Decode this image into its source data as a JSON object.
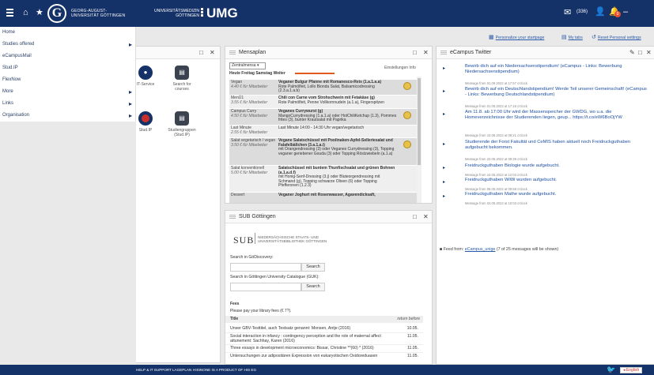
{
  "topbar": {
    "uni_name": "GEORG-AUGUST-UNIVERSITÄT GÖTTINGEN",
    "ugm_small": "UNIVERSITÄTSMEDIZIN GÖTTINGEN",
    "ugm": "UMG",
    "mail_count": "(336)",
    "notif_count": "0"
  },
  "nav": {
    "items": [
      {
        "label": "Home",
        "has_children": false
      },
      {
        "label": "Studies offered",
        "has_children": true
      },
      {
        "label": "eCampusMail",
        "has_children": false
      },
      {
        "label": "Stud.IP",
        "has_children": false
      },
      {
        "label": "FlexNow",
        "has_children": false
      },
      {
        "label": "More",
        "has_children": true
      },
      {
        "label": "Links",
        "has_children": true
      },
      {
        "label": "Organisation",
        "has_children": true
      }
    ]
  },
  "tools": {
    "personalize": "Personalize your startpage",
    "my_tabs": "My tabs",
    "reset": "Reset Personal settings"
  },
  "quicklinks": {
    "items": [
      {
        "label": "IT-Service"
      },
      {
        "label": "Search for courses"
      },
      {
        "label": "Stud.IP"
      },
      {
        "label": "Studiengruppen (Stud.IP)"
      }
    ]
  },
  "mensa": {
    "title": "Mensaplan",
    "select": "Zentralmensa",
    "date": "Heute Freitag Samstag Weiter",
    "info_link": "Einstellungen Info",
    "rows": [
      {
        "cat": "Vegan",
        "price": "4.40 € für Mitarbeiter",
        "name": "Veganer Bulgur Pfanne mit Romanesco-Reis (1.a.1.a.a)",
        "desc": "Rote Palmölfeit, Lollo Bionda Salat, Balsamicodressing (2.3.a.1.a.b)"
      },
      {
        "cat": "MenÜ1",
        "price": "3.55 € für Mitarbeiter",
        "name": "Chili con Carne vom Strohschwein mit Fetakäse (g)",
        "desc": "Rote Palmölfeit, Penne Vollkornnudeln (a.1.a), Fingerspitzen"
      },
      {
        "cat": "Campus Curry",
        "price": "4.50 € für Mitarbeiter",
        "name": "Veganes Currywurst (g)",
        "desc": "MangoCurrydressing (1.a.1.a) oder HotChiliKetchup (1.3), Pommes frites (3), bunter Krautsalat mit Paprika"
      },
      {
        "cat": "Last Minute",
        "price": "2.55 € für Mitarbeiter",
        "name": "",
        "desc": "Last Minute 14:00 - 14:30 Uhr vegan/vegetarisch"
      },
      {
        "cat": "Salat vegetarisch / vegan",
        "price": "3.50 € für Mitarbeiter",
        "name": "Vegane Salatschüssel mit Poolinaken-Apfel-Selleriesalat und Falafelbällchen (3.a.1.a.i)",
        "desc": "mit Orangendressing (3) oder Veganes Currydressing (3), Topping veganer geriebener Gouda (3) oder Topping Röstzwiebeln (a.1.a)"
      },
      {
        "cat": "Salat konventionell",
        "price": "5.00 € für Mitarbeiter",
        "name": "Salatschüssel mit buntem Thunfischsalat und grünen Bohnen (a.1.a.d.f)",
        "desc": "mit Honig-Senf-Dressing (3.j) oder Bluteorgendressing mit Schmand (g), Topping schwarze Oliven (6) oder Topping Pfefferonen (1.2.3)"
      },
      {
        "cat": "Dessert",
        "price": "",
        "name": "Veganer Joghurt mit Rosenwasser, Agavendicksaft,",
        "desc": ""
      }
    ]
  },
  "sub": {
    "title": "SUB Göttingen",
    "logo": "SUB",
    "logo_text": "NIEDERSÄCHSISCHE STAATS- UND UNIVERSITÄTSBIBLIOTHEK GÖTTINGEN",
    "search_label_1": "Search in GöDiscovery:",
    "search_label_2": "Search in Göttingen University Catalogue (GUK):",
    "search_btn": "Search",
    "fees_heading": "Fees",
    "fees_text": "Please pay your library fees (€ 7?).",
    "loans_title": "Title",
    "loans_return": "return before",
    "loans": [
      {
        "title": "Unser GBV-Testtitel, auch Testsatz genannt: Monsen, Antje (2016)",
        "date": "10.05."
      },
      {
        "title": "Social interaction in infancy : contingency perception and the role of maternal affect attunement: Sachhay, Karen (2016)",
        "date": "11.05."
      },
      {
        "title": "Three essays in development microeconomics: Bissar, Christine **(60) * (2016)",
        "date": "11.05."
      },
      {
        "title": "Untersuchungen zur adipositären Expression von eukaryotischen Oxidoreduasen",
        "date": "11.05."
      }
    ]
  },
  "twitter": {
    "title": "eCampus Twitter",
    "tweets": [
      {
        "text": "Bewirb dich auf ein Niedersachsenstipendium! (eCampus - Links: Bewerbung Niedersachsenstipendium)",
        "meta": "Message from 01.09.2022 at 17:57 o'clock"
      },
      {
        "text": "Bewirb dich auf ein Deutschlandstipendium! Werde Teil unserer Gemeinschaft! (eCampus - Links: Bewerbung Deutschlandstipendium)",
        "meta": "Message from 01.09.2022 at 17:16 o'clock"
      },
      {
        "text": "Am 11.8. ab 17:00 Uhr wird der Massenspeicher der GWDG, wo u.a. die Homeverzeichnisse der Studierenden liegen, geup... https://t.co/eW6BoOjYW",
        "meta": "Message from 10.08.2022 at 09:21 o'clock"
      },
      {
        "text": "Studierende der Forst Fakultät und CeMIS haben aktuell noch Freidruckguthaben aufgebucht bekommen.",
        "meta": "Message from 22.05.2022 at 09:39 o'clock"
      },
      {
        "text": "Freidruckguthaben Biologie wurde aufgebucht.",
        "meta": "Message from 10.05.2022 at 12:03 o'clock"
      },
      {
        "text": "Freidruckguthaben WiWi wurden aufgebucht.",
        "meta": "Message from 05.05.2022 at 09:58 o'clock"
      },
      {
        "text": "Freidruckguthaben Mathe wurde aufgebucht.",
        "meta": "Message from 04.05.2022 at 10:03 o'clock"
      }
    ],
    "feed_prefix": "Feed from:",
    "feed_link": "eCampus_unige",
    "feed_suffix": "(7 of 25 messages will be shown)"
  },
  "footer": {
    "help": "HELP & IT SUPPORT",
    "lageplan": "LAGEPLAN",
    "product": "HISINONE IS A PRODUCT OF HIS EG",
    "lang": "English"
  }
}
